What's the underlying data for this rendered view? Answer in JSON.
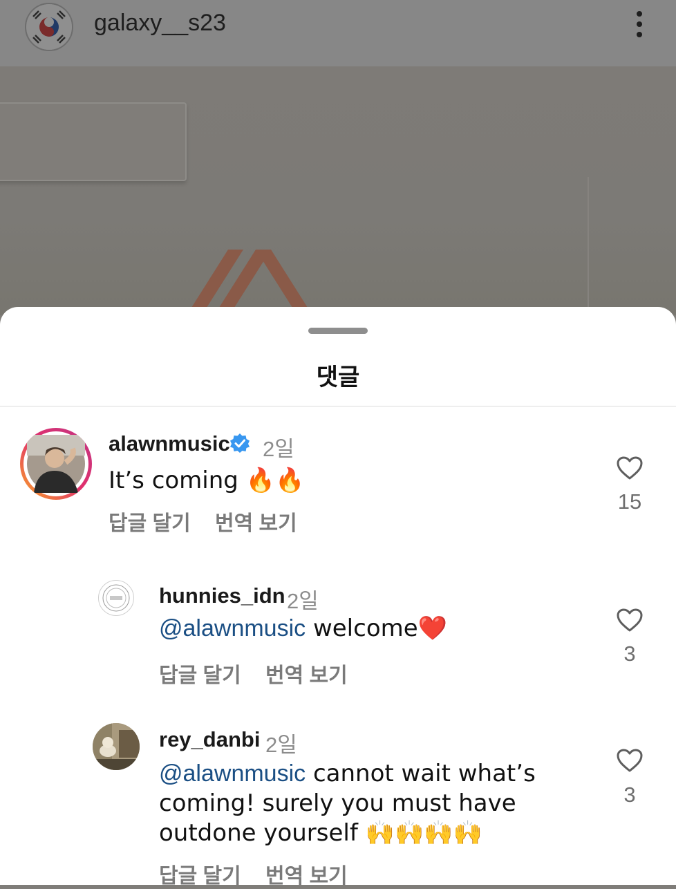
{
  "post": {
    "username": "galaxy__s23"
  },
  "sheet": {
    "title": "댓글"
  },
  "comments": [
    {
      "username": "alawnmusic",
      "verified": true,
      "time": "2일",
      "text": "It’s coming 🔥🔥",
      "reply_label": "답글 달기",
      "translate_label": "번역 보기",
      "likes": "15"
    },
    {
      "username": "hunnies_idn",
      "time": "2일",
      "mention": "@alawnmusic",
      "text": " welcome❤️",
      "reply_label": "답글 달기",
      "translate_label": "번역 보기",
      "likes": "3"
    },
    {
      "username": "rey_danbi",
      "time": "2일",
      "mention": "@alawnmusic",
      "text": " cannot wait what’s coming! surely you must have outdone yourself 🙌🙌🙌🙌",
      "reply_label": "답글 달기",
      "translate_label": "번역 보기",
      "likes": "3"
    }
  ],
  "colors": {
    "mention": "#1b4f84",
    "verified": "#3897f0",
    "story_ring_start": "#f9a825",
    "story_ring_end": "#c13584"
  }
}
